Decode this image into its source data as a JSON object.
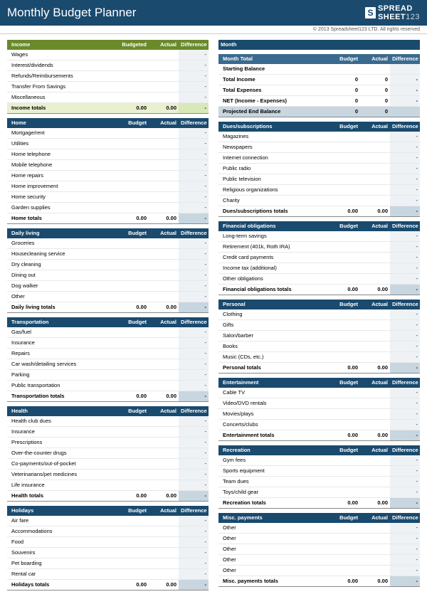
{
  "title": "Monthly Budget Planner",
  "brand": "SPREADSHEET123",
  "copyright": "© 2013 Spreadsheet123 LTD. All rights reserved",
  "cols": {
    "budget": "Budget",
    "budgeted": "Budgeted",
    "actual": "Actual",
    "diff": "Difference"
  },
  "month_label": "Month",
  "month_value": "",
  "month_total": {
    "header": "Month Total",
    "rows": [
      {
        "label": "Starting Balance",
        "b": "",
        "a": "",
        "d": ""
      },
      {
        "label": "Total Income",
        "b": "0",
        "a": "0",
        "d": "-"
      },
      {
        "label": "Total Expenses",
        "b": "0",
        "a": "0",
        "d": "-"
      },
      {
        "label": "NET (Income - Expenses)",
        "b": "0",
        "a": "0",
        "d": "-"
      }
    ],
    "projected": {
      "label": "Projected End Balance",
      "b": "0",
      "a": "0",
      "d": ""
    }
  },
  "income": {
    "header": "Income",
    "items": [
      "Wages",
      "Interest/dividends",
      "Refunds/Reimbursements",
      "Transfer From Savings",
      "Miscellaneous"
    ],
    "totals_label": "Income totals",
    "tb": "0.00",
    "ta": "0.00",
    "td": "-"
  },
  "left": [
    {
      "header": "Home",
      "items": [
        "Mortgage/rent",
        "Utilities",
        "Home telephone",
        "Mobile telephone",
        "Home repairs",
        "Home improvement",
        "Home security",
        "Garden supplies"
      ],
      "totals_label": "Home totals",
      "tb": "0.00",
      "ta": "0.00",
      "td": "-"
    },
    {
      "header": "Daily living",
      "items": [
        "Groceries",
        "Housecleaning service",
        "Dry cleaning",
        "Dining out",
        "Dog walker",
        "Other"
      ],
      "totals_label": "Daily living totals",
      "tb": "0.00",
      "ta": "0.00",
      "td": "-"
    },
    {
      "header": "Transportation",
      "items": [
        "Gas/fuel",
        "Insurance",
        "Repairs",
        "Car wash/detailing services",
        "Parking",
        "Public transportation"
      ],
      "totals_label": "Transportation totals",
      "tb": "0.00",
      "ta": "0.00",
      "td": "-"
    },
    {
      "header": "Health",
      "items": [
        "Health club dues",
        "Insurance",
        "Prescriptions",
        "Over-the-counter drugs",
        "Co-payments/out-of-pocket",
        "Veterinarians/pet medicines",
        "Life insurance"
      ],
      "totals_label": "Health totals",
      "tb": "0.00",
      "ta": "0.00",
      "td": "-"
    },
    {
      "header": "Holidays",
      "items": [
        "Air fare",
        "Accommodations",
        "Food",
        "Souvenirs",
        "Pet boarding",
        "Rental car"
      ],
      "totals_label": "Holidays totals",
      "tb": "0.00",
      "ta": "0.00",
      "td": "-"
    }
  ],
  "right": [
    {
      "header": "Dues/subscriptions",
      "items": [
        "Magazines",
        "Newspapers",
        "Internet connection",
        "Public radio",
        "Public television",
        "Religious organizations",
        "Charity"
      ],
      "totals_label": "Dues/subscriptions totals",
      "tb": "0.00",
      "ta": "0.00",
      "td": "-"
    },
    {
      "header": "Financial obligations",
      "items": [
        "Long-term savings",
        "Retirement (401k, Roth IRA)",
        "Credit card payments",
        "Income tax (additional)",
        "Other obligations"
      ],
      "totals_label": "Financial obligations totals",
      "tb": "0.00",
      "ta": "0.00",
      "td": "-"
    },
    {
      "header": "Personal",
      "items": [
        "Clothing",
        "Gifts",
        "Salon/barber",
        "Books",
        "Music (CDs, etc.)"
      ],
      "totals_label": "Personal totals",
      "tb": "0.00",
      "ta": "0.00",
      "td": "-"
    },
    {
      "header": "Entertainment",
      "items": [
        "Cable TV",
        "Video/DVD rentals",
        "Movies/plays",
        "Concerts/clubs"
      ],
      "totals_label": "Entertainment totals",
      "tb": "0.00",
      "ta": "0.00",
      "td": "-"
    },
    {
      "header": "Recreation",
      "items": [
        "Gym fees",
        "Sports equipment",
        "Team dues",
        "Toys/child gear"
      ],
      "totals_label": "Recreation totals",
      "tb": "0.00",
      "ta": "0.00",
      "td": "-"
    },
    {
      "header": "Misc. payments",
      "items": [
        "Other",
        "Other",
        "Other",
        "Other",
        "Other"
      ],
      "totals_label": "Misc. payments totals",
      "tb": "0.00",
      "ta": "0.00",
      "td": "-"
    }
  ]
}
